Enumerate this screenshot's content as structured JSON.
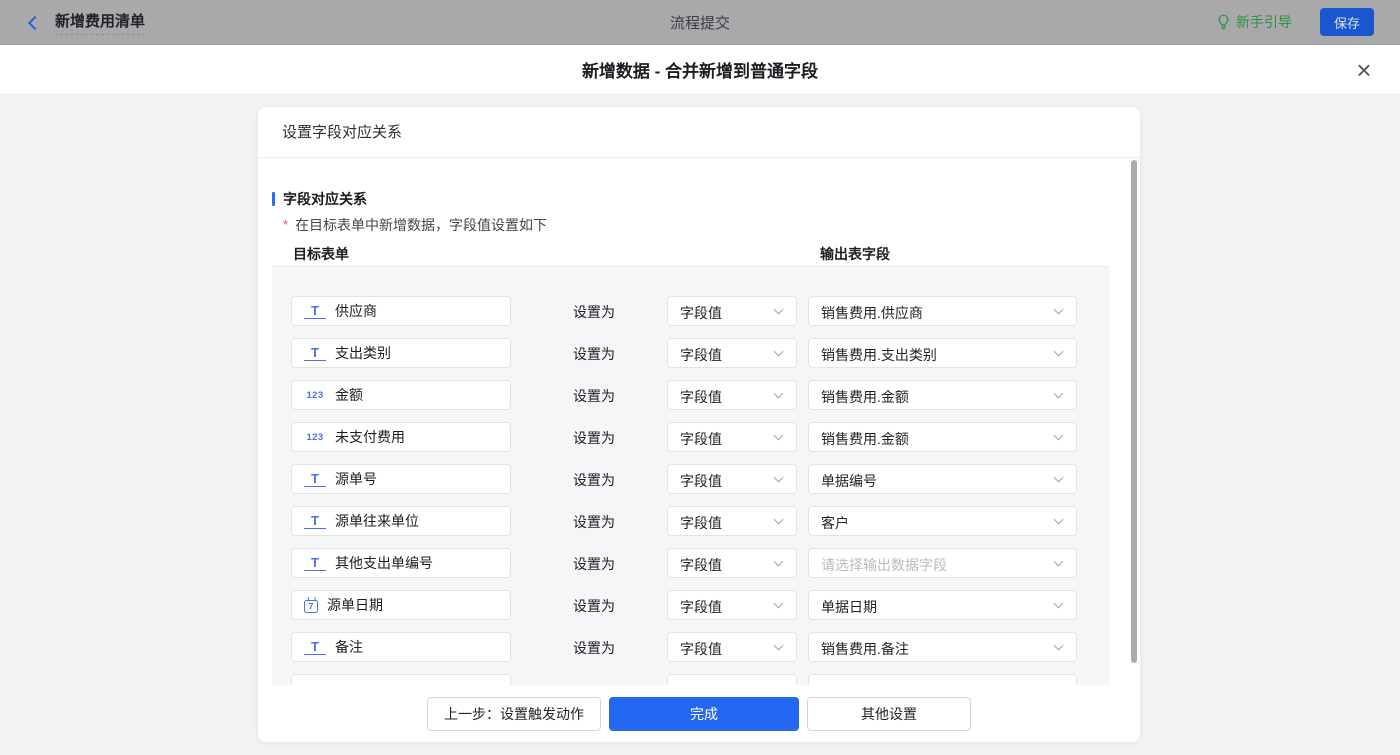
{
  "topbar": {
    "back_label": "新增费用清单",
    "center_title": "流程提交",
    "guide_label": "新手引导",
    "save_label": "保存"
  },
  "modal": {
    "title": "新增数据 - 合并新增到普通字段",
    "close_icon": "×"
  },
  "card": {
    "header_title": "设置字段对应关系",
    "section_title": "字段对应关系",
    "required_mark": "*",
    "note": "在目标表单中新增数据，字段值设置如下",
    "columns": {
      "target": "目标表单",
      "output": "输出表字段"
    },
    "set_as_label": "设置为",
    "icons": {
      "text": "T",
      "number": "123",
      "date": "7"
    },
    "rows": [
      {
        "icon": "text",
        "field": "供应商",
        "mode": "字段值",
        "output": "销售费用.供应商",
        "placeholder": false
      },
      {
        "icon": "text",
        "field": "支出类别",
        "mode": "字段值",
        "output": "销售费用.支出类别",
        "placeholder": false
      },
      {
        "icon": "number",
        "field": "金额",
        "mode": "字段值",
        "output": "销售费用.金额",
        "placeholder": false
      },
      {
        "icon": "number",
        "field": "未支付费用",
        "mode": "字段值",
        "output": "销售费用.金额",
        "placeholder": false
      },
      {
        "icon": "text",
        "field": "源单号",
        "mode": "字段值",
        "output": "单据编号",
        "placeholder": false
      },
      {
        "icon": "text",
        "field": "源单往来单位",
        "mode": "字段值",
        "output": "客户",
        "placeholder": false
      },
      {
        "icon": "text",
        "field": "其他支出单编号",
        "mode": "字段值",
        "output": "请选择输出数据字段",
        "placeholder": true
      },
      {
        "icon": "date",
        "field": "源单日期",
        "mode": "字段值",
        "output": "单据日期",
        "placeholder": false
      },
      {
        "icon": "text",
        "field": "备注",
        "mode": "字段值",
        "output": "销售费用.备注",
        "placeholder": false
      }
    ],
    "footer": {
      "prev_label": "上一步：设置触发动作",
      "done_label": "完成",
      "other_label": "其他设置"
    }
  },
  "colors": {
    "primary_blue": "#2468f2",
    "topbar_save_blue": "#1857ce",
    "guide_green": "#2b9341",
    "field_icon_blue": "#4d6fee",
    "section_bar_blue": "#2e6bff",
    "required_red": "#ea4f55",
    "topbar_bg": "#a9a9ab",
    "panel_bg": "#f5f6f8"
  }
}
